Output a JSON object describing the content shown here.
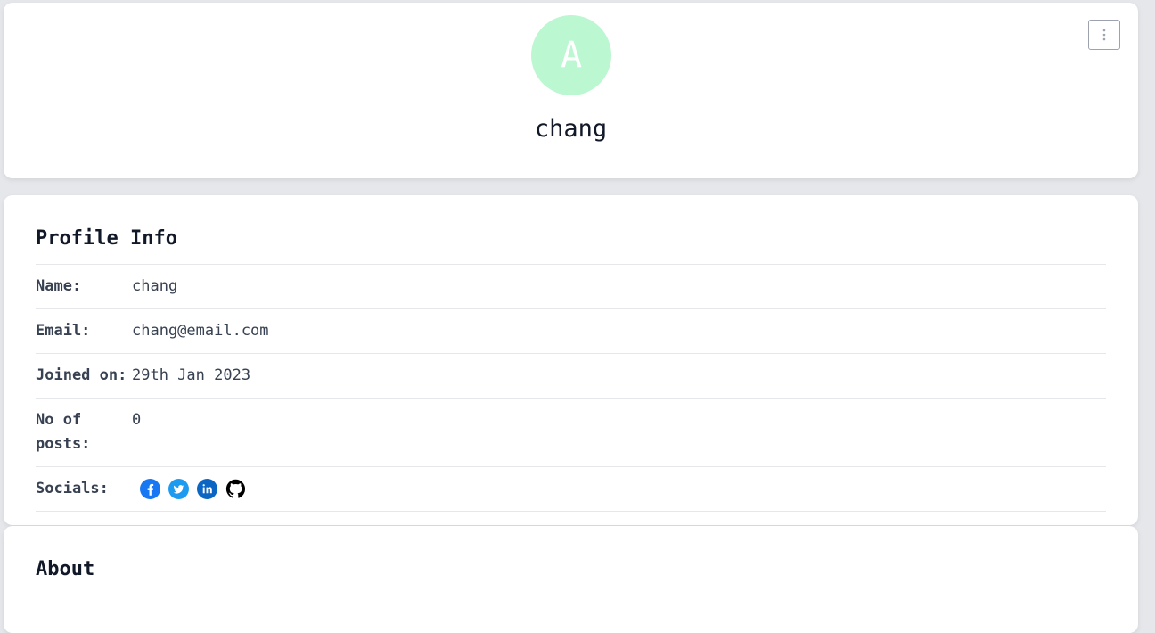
{
  "profile": {
    "avatar_initial": "A",
    "username": "chang",
    "avatar_color": "#bbf7d0"
  },
  "menu": {
    "icon": "vertical-dots-icon"
  },
  "profile_info": {
    "title": "Profile Info",
    "name_label": "Name:",
    "name_value": "chang",
    "email_label": "Email:",
    "email_value": "chang@email.com",
    "joined_label": "Joined on:",
    "joined_value": "29th Jan 2023",
    "posts_label": "No of posts:",
    "posts_value": "0",
    "socials_label": "Socials:",
    "socials": [
      {
        "name": "facebook-icon",
        "color": "#1877f2"
      },
      {
        "name": "twitter-icon",
        "color": "#1d9bf0"
      },
      {
        "name": "linkedin-icon",
        "color": "#0a66c2"
      },
      {
        "name": "github-icon",
        "color": "#000000"
      }
    ]
  },
  "about": {
    "title": "About"
  }
}
